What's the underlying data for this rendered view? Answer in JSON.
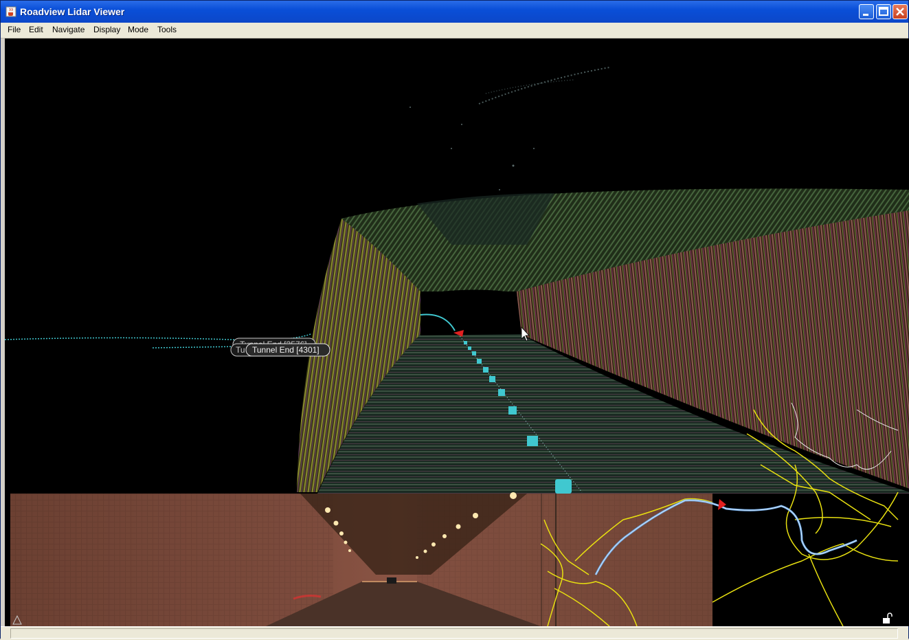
{
  "window": {
    "title": "Roadview Lidar Viewer",
    "controls": [
      "minimize",
      "maximize",
      "close"
    ]
  },
  "menubar": {
    "items": [
      "File",
      "Edit",
      "Navigate",
      "Display",
      "Mode",
      "Tools"
    ]
  },
  "viewport": {
    "labels": [
      {
        "text": "Tunnel End [3576]"
      },
      {
        "text": "Tunnel End [4301]"
      }
    ],
    "label_behind_prefix": "Tu"
  },
  "icons": {
    "app": "java-cup-icon",
    "overlay_toggle": "triangle-icon",
    "lock": "unlock-icon",
    "cursor": "mouse-pointer-icon"
  },
  "colors": {
    "titlebar": "#0a4fd8",
    "trajectory": "#40c8d0",
    "map_roads": "#e8e010",
    "route": "#6aa8e8",
    "marker": "#e02020"
  }
}
